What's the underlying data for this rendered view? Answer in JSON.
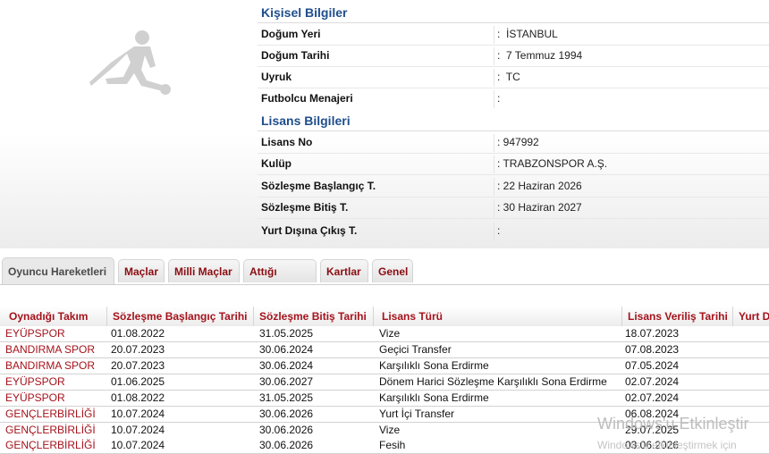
{
  "personal": {
    "title": "Kişisel Bilgiler",
    "rows": [
      {
        "label": "Doğum Yeri",
        "value": ":  İSTANBUL"
      },
      {
        "label": "Doğum Tarihi",
        "value": ":  7 Temmuz 1994"
      },
      {
        "label": "Uyruk",
        "value": ":  TC"
      },
      {
        "label": "Futbolcu Menajeri",
        "value": ":"
      }
    ]
  },
  "license": {
    "title": "Lisans Bilgileri",
    "rows": [
      {
        "label": "Lisans No",
        "value": ": 947992"
      },
      {
        "label": "Kulüp",
        "value": ": TRABZONSPOR A.Ş."
      },
      {
        "label": "Sözleşme Başlangıç T.",
        "value": ": 22 Haziran 2026"
      },
      {
        "label": "Sözleşme Bitiş T.",
        "value": ": 30 Haziran 2027"
      },
      {
        "label": "Yurt Dışına Çıkış T.",
        "value": ":"
      }
    ]
  },
  "tabs": [
    {
      "label": "Oyuncu Hareketleri",
      "active": true
    },
    {
      "label": "Maçlar",
      "active": false
    },
    {
      "label": "Milli Maçlar",
      "active": false
    },
    {
      "label": "Attığı Goller",
      "active": false
    },
    {
      "label": "Kartlar",
      "active": false
    },
    {
      "label": "Genel",
      "active": false
    }
  ],
  "table": {
    "headers": [
      "Oynadığı Takım",
      "Sözleşme Başlangıç Tarihi",
      "Sözleşme Bitiş Tarihi",
      "Lisans Türü",
      "Lisans Veriliş Tarihi",
      "Yurt Dı"
    ],
    "rows": [
      [
        "EYÜPSPOR",
        "01.08.2022",
        "31.05.2025",
        "Vize",
        "18.07.2023"
      ],
      [
        "BANDIRMA SPOR",
        "20.07.2023",
        "30.06.2024",
        "Geçici Transfer",
        "07.08.2023"
      ],
      [
        "BANDIRMA SPOR",
        "20.07.2023",
        "30.06.2024",
        "Karşılıklı Sona Erdirme",
        "07.05.2024"
      ],
      [
        "EYÜPSPOR",
        "01.06.2025",
        "30.06.2027",
        "Dönem Harici Sözleşme Karşılıklı Sona Erdirme",
        "02.07.2024"
      ],
      [
        "EYÜPSPOR",
        "01.08.2022",
        "31.05.2025",
        "Karşılıklı Sona Erdirme",
        "02.07.2024"
      ],
      [
        "GENÇLERBİRLİĞİ",
        "10.07.2024",
        "30.06.2026",
        "Yurt İçi Transfer",
        "06.08.2024"
      ],
      [
        "GENÇLERBİRLİĞİ",
        "10.07.2024",
        "30.06.2026",
        "Vize",
        "29.07.2025"
      ],
      [
        "GENÇLERBİRLİĞİ",
        "10.07.2024",
        "30.06.2026",
        "Fesih",
        "03.06.2026"
      ]
    ]
  },
  "watermark": {
    "line1": "Windows'u Etkinleştir",
    "line2": "Windows'u etkinleştirmek için"
  },
  "colors": {
    "section_title": "#1f4e8c",
    "tab_text": "#8b0d12",
    "header_text": "#a5121b",
    "team_text": "#a5121b"
  }
}
